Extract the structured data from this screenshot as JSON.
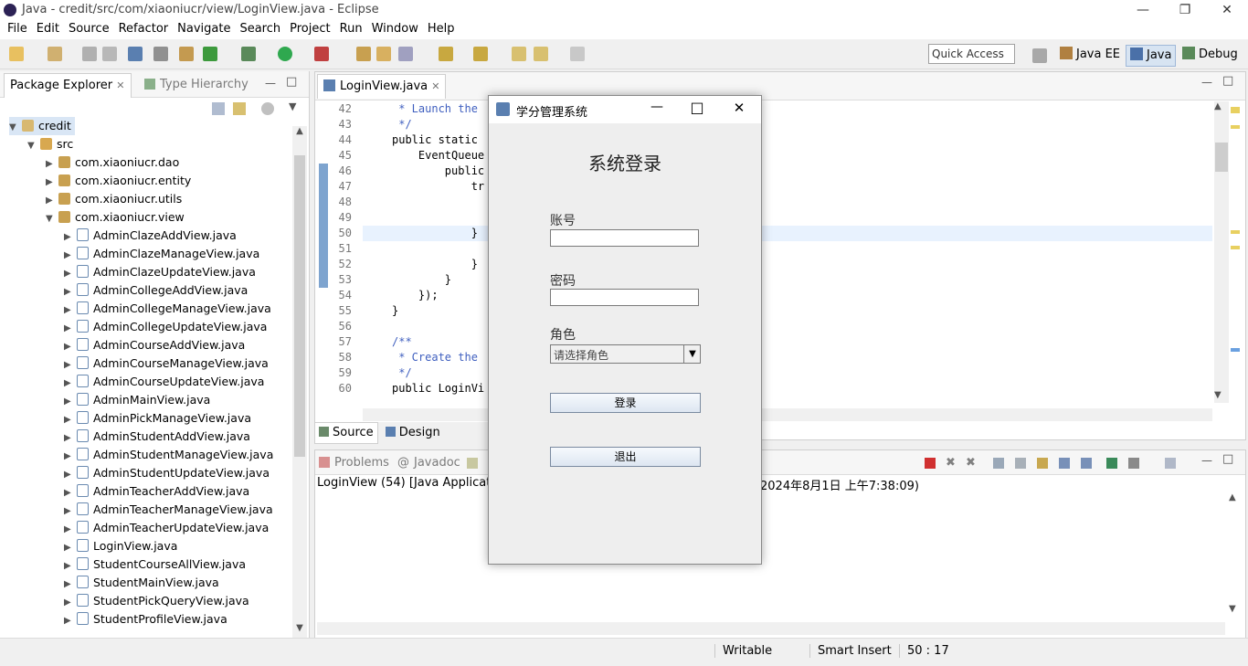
{
  "window": {
    "title": "Java - credit/src/com/xiaoniucr/view/LoginView.java - Eclipse"
  },
  "menu": [
    "File",
    "Edit",
    "Source",
    "Refactor",
    "Navigate",
    "Search",
    "Project",
    "Run",
    "Window",
    "Help"
  ],
  "toolbar": {
    "quick_access": "Quick Access"
  },
  "perspectives": {
    "javaee": "Java EE",
    "java": "Java",
    "debug": "Debug"
  },
  "package_explorer": {
    "tab": "Package Explorer",
    "type_hierarchy": "Type Hierarchy",
    "project": "credit",
    "src": "src",
    "packages": [
      "com.xiaoniucr.dao",
      "com.xiaoniucr.entity",
      "com.xiaoniucr.utils",
      "com.xiaoniucr.view"
    ],
    "files": [
      "AdminClazeAddView.java",
      "AdminClazeManageView.java",
      "AdminClazeUpdateView.java",
      "AdminCollegeAddView.java",
      "AdminCollegeManageView.java",
      "AdminCollegeUpdateView.java",
      "AdminCourseAddView.java",
      "AdminCourseManageView.java",
      "AdminCourseUpdateView.java",
      "AdminMainView.java",
      "AdminPickManageView.java",
      "AdminStudentAddView.java",
      "AdminStudentManageView.java",
      "AdminStudentUpdateView.java",
      "AdminTeacherAddView.java",
      "AdminTeacherManageView.java",
      "AdminTeacherUpdateView.java",
      "LoginView.java",
      "StudentCourseAllView.java",
      "StudentMainView.java",
      "StudentPickQueryView.java",
      "StudentProfileView.java"
    ]
  },
  "editor": {
    "tab": "LoginView.java",
    "lines": [
      {
        "n": "42",
        "text": " * Launch the"
      },
      {
        "n": "43",
        "text": " */"
      },
      {
        "n": "44",
        "text": "public static"
      },
      {
        "n": "45",
        "text": "    EventQueue"
      },
      {
        "n": "46",
        "text": "        public"
      },
      {
        "n": "47",
        "text": "            tr"
      },
      {
        "n": "48",
        "text": ""
      },
      {
        "n": "49",
        "text": ""
      },
      {
        "n": "50",
        "text": "            }"
      },
      {
        "n": "51",
        "text": ""
      },
      {
        "n": "52",
        "text": "            }"
      },
      {
        "n": "53",
        "text": "        }"
      },
      {
        "n": "54",
        "text": "    });"
      },
      {
        "n": "55",
        "text": "}"
      },
      {
        "n": "56",
        "text": ""
      },
      {
        "n": "57",
        "text": "/**"
      },
      {
        "n": "58",
        "text": " * Create the"
      },
      {
        "n": "59",
        "text": " */"
      },
      {
        "n": "60",
        "text": "public LoginVi"
      }
    ],
    "source_tab": "Source",
    "design_tab": "Design"
  },
  "console": {
    "problems": "Problems",
    "javadoc": "Javadoc",
    "launch_left": "LoginView (54) [Java Application]",
    "launch_right": "2024年8月1日 上午7:38:09)"
  },
  "status": {
    "writable": "Writable",
    "insert": "Smart Insert",
    "position": "50 : 17"
  },
  "dialog": {
    "title": "学分管理系统",
    "heading": "系统登录",
    "account_label": "账号",
    "password_label": "密码",
    "role_label": "角色",
    "role_placeholder": "请选择角色",
    "login_button": "登录",
    "exit_button": "退出"
  }
}
